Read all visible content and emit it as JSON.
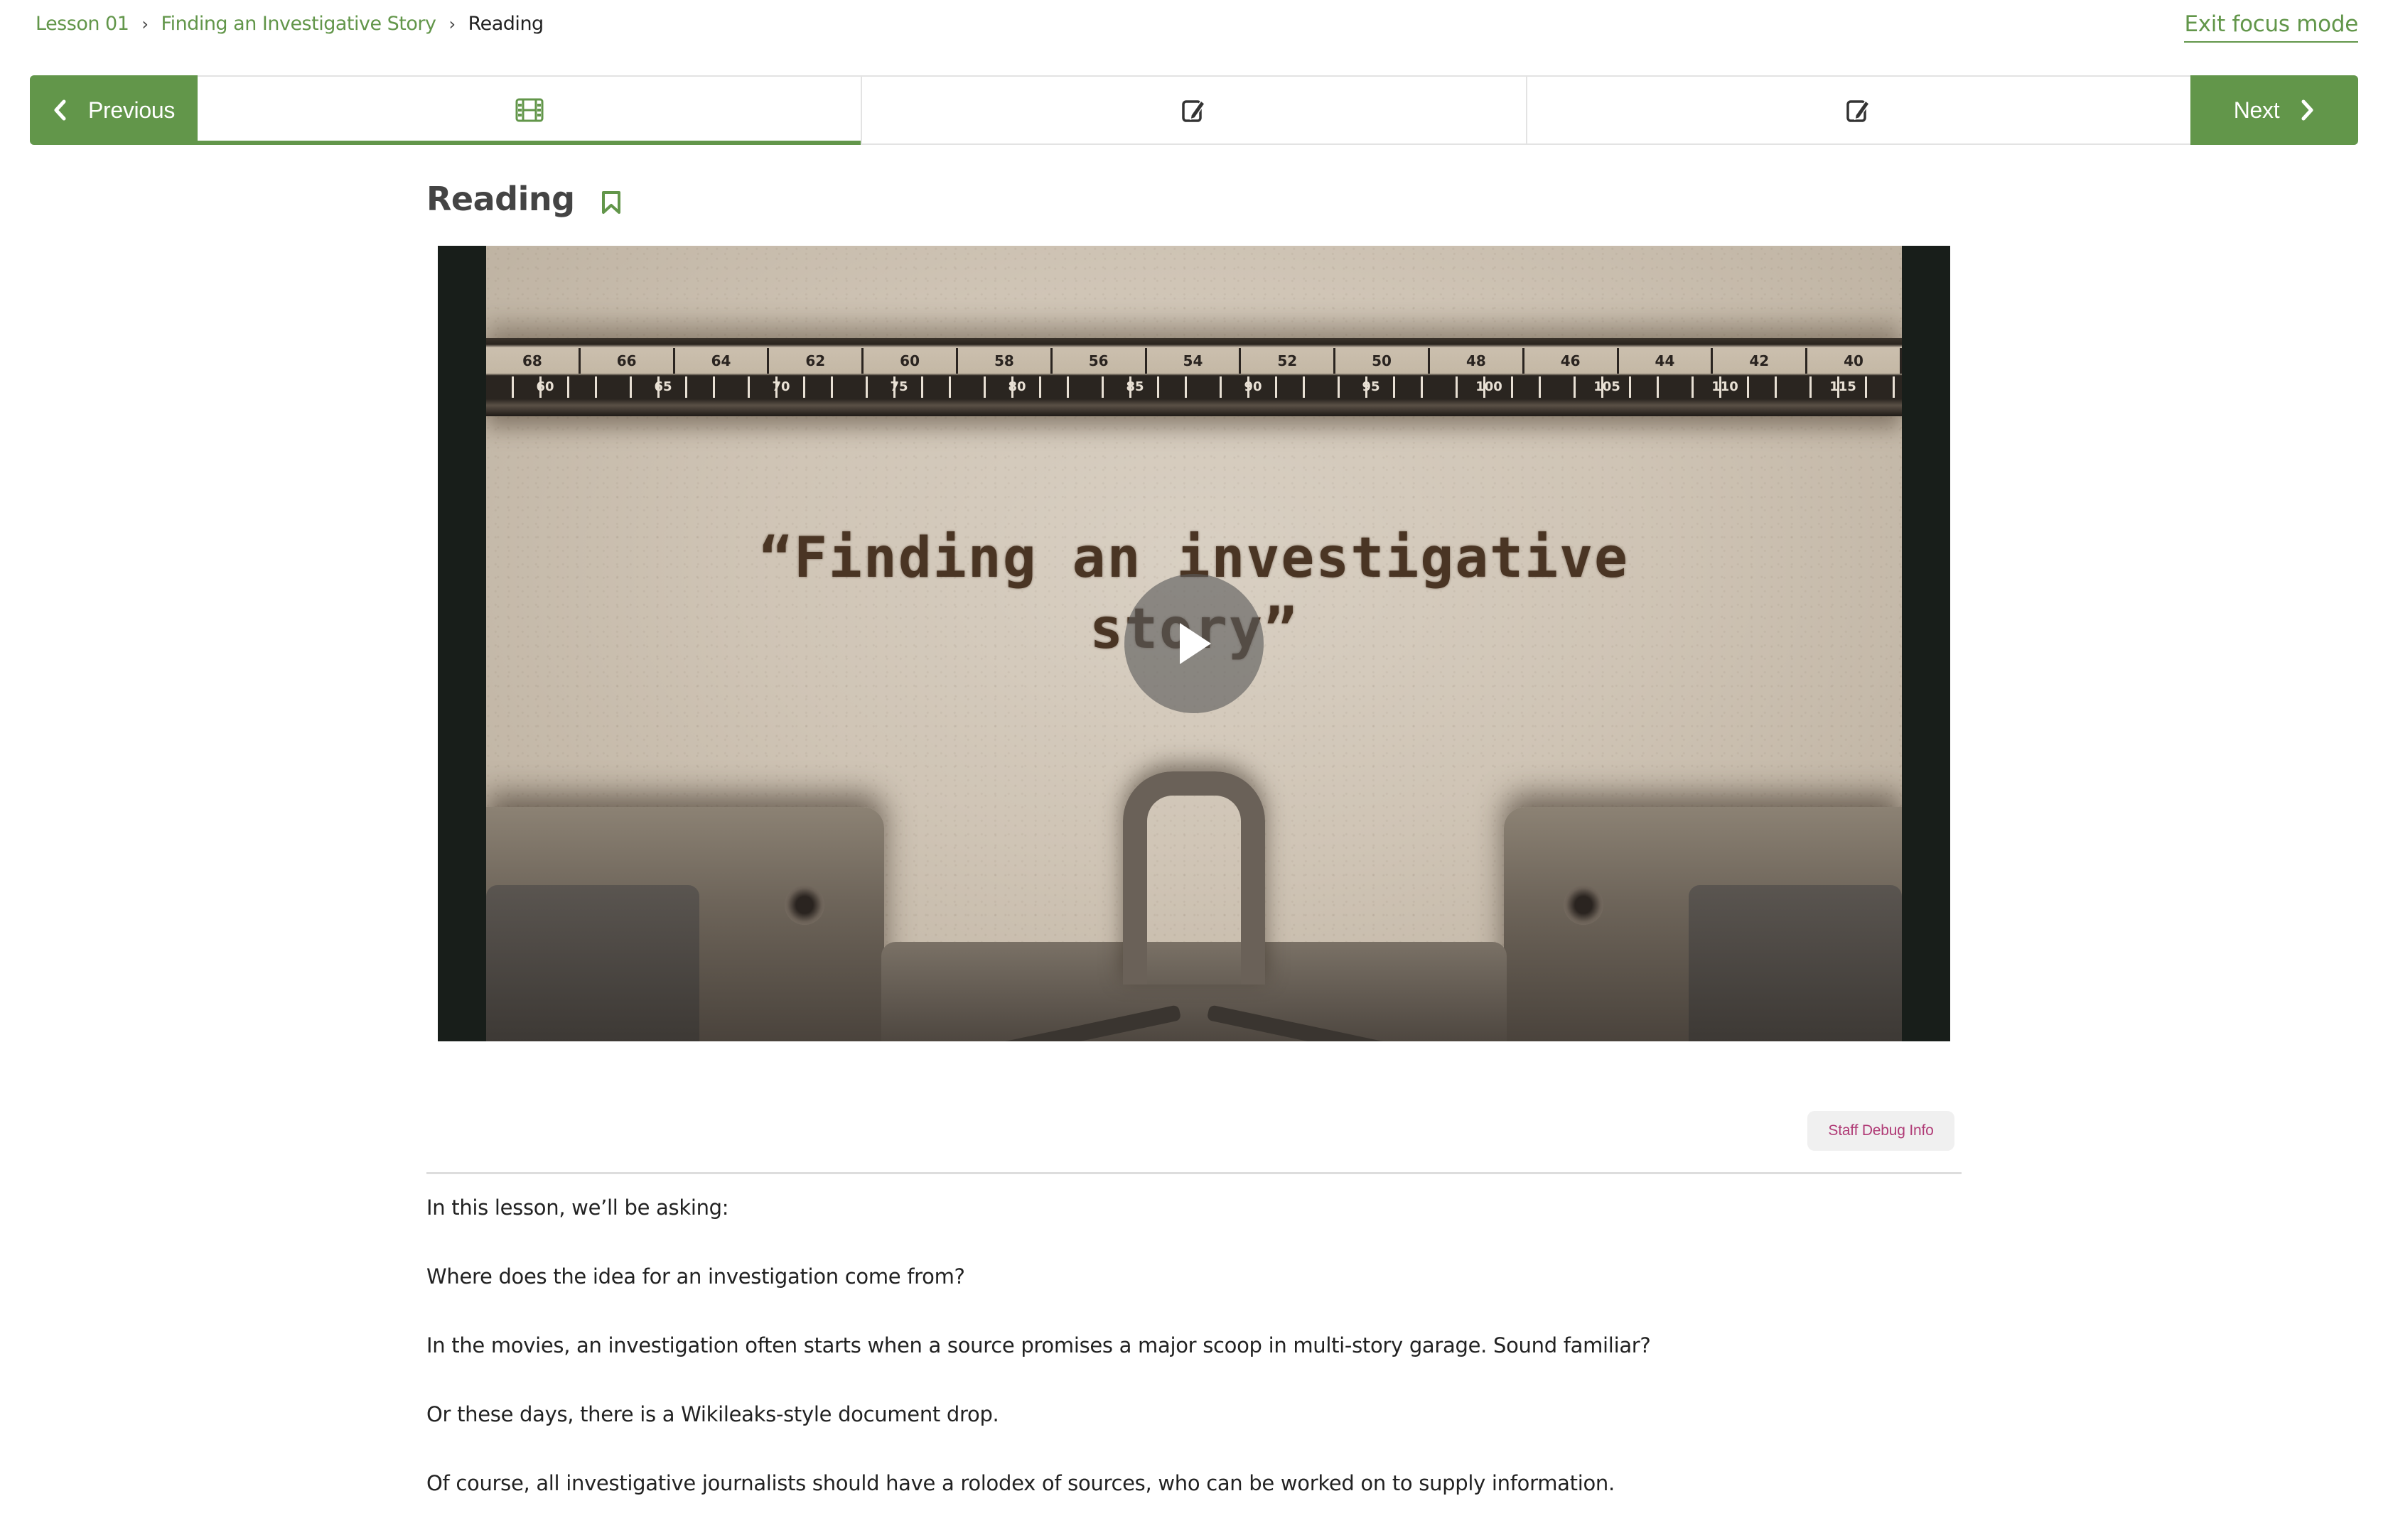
{
  "breadcrumb": {
    "items": [
      {
        "label": "Lesson 01",
        "link": true
      },
      {
        "label": "Finding an Investigative Story",
        "link": true
      },
      {
        "label": "Reading",
        "link": false
      }
    ],
    "separator_icon": "chevron-right-icon"
  },
  "header": {
    "exit_focus_label": "Exit focus mode"
  },
  "sequence_nav": {
    "previous_label": "Previous",
    "next_label": "Next",
    "tabs": [
      {
        "icon": "video-film-icon",
        "active": true
      },
      {
        "icon": "edit-problem-icon",
        "active": false
      },
      {
        "icon": "edit-problem-icon",
        "active": false
      }
    ]
  },
  "unit": {
    "title": "Reading",
    "bookmark_icon": "bookmark-icon"
  },
  "video": {
    "thumbnail_text_line1": "“Finding an investigative",
    "thumbnail_text_line2": "story”",
    "ruler_top": [
      "68",
      "66",
      "64",
      "62",
      "60",
      "58",
      "56",
      "54",
      "52",
      "50",
      "48",
      "46",
      "44",
      "42",
      "40"
    ],
    "ruler_bottom": [
      "60",
      "65",
      "70",
      "75",
      "80",
      "85",
      "90",
      "95",
      "100",
      "105",
      "110",
      "115"
    ],
    "play_icon": "play-icon"
  },
  "staff_debug_label": "Staff Debug Info",
  "body": {
    "paragraphs": [
      "In this lesson, we’ll be asking:",
      "Where does the idea for an investigation come from?",
      "In the movies, an investigation often starts when a source promises a major scoop in multi-story garage. Sound familiar?",
      "Or these days, there is a Wikileaks-style document drop.",
      "Of course, all investigative journalists should have a rolodex of sources, who can be worked on to supply information."
    ]
  },
  "colors": {
    "brand_green": "#62964a",
    "debug_text": "#b03b76",
    "body_text": "#222222"
  }
}
